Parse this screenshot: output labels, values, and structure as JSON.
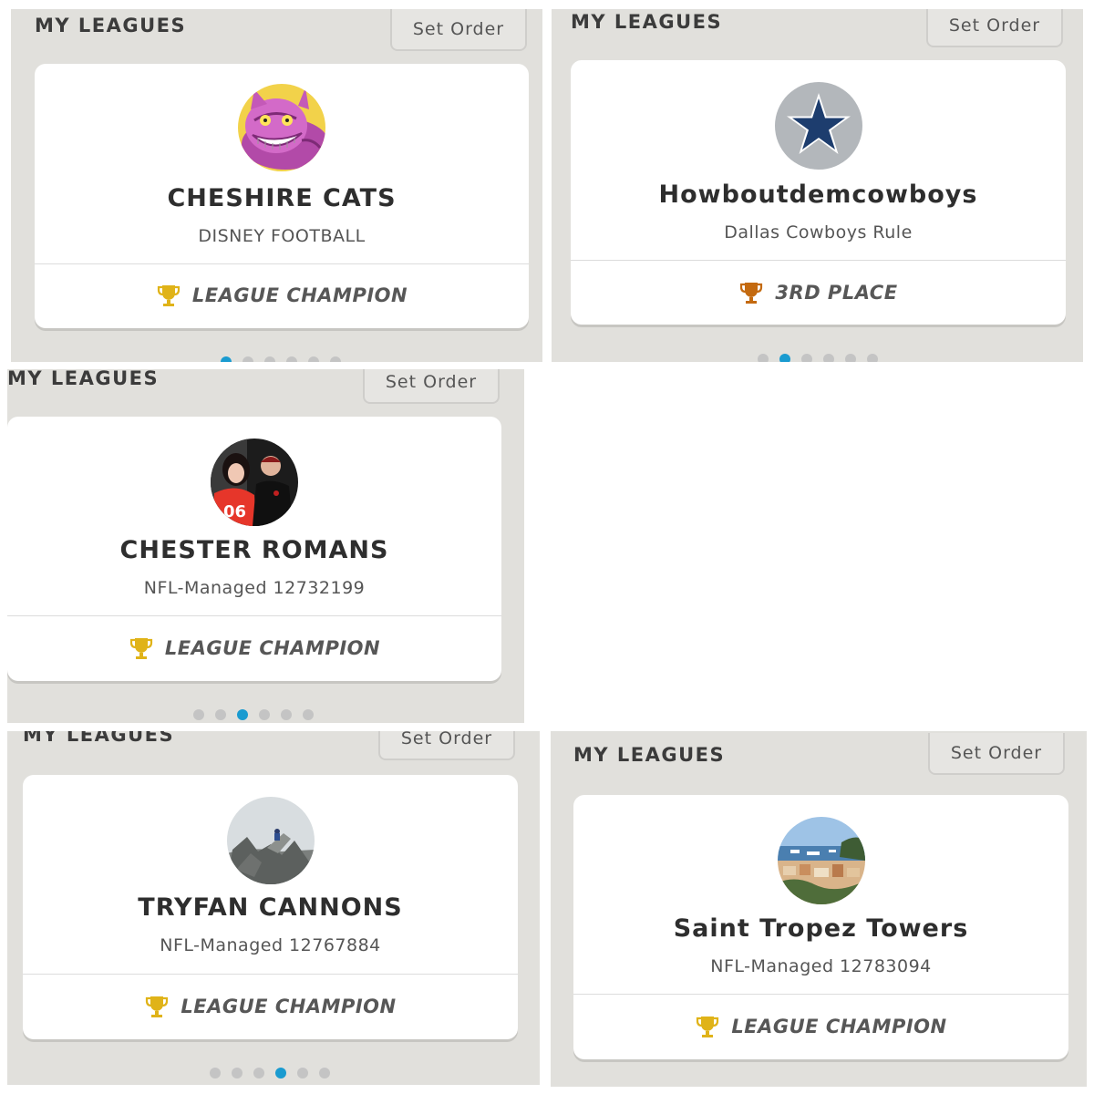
{
  "header_title": "MY LEAGUES",
  "set_order_label": "Set Order",
  "colors": {
    "panel_bg": "#e1e0dc",
    "card_bg": "#ffffff",
    "gold_trophy": "#e0b318",
    "bronze_trophy": "#c46a10",
    "active_dot": "#1a9bd0",
    "inactive_dot": "#c4c4c4"
  },
  "panels": [
    {
      "team_name": "CHESHIRE CATS",
      "league_name": "DISNEY FOOTBALL",
      "achievement": "LEAGUE CHAMPION",
      "trophy": "gold",
      "avatar": "cheshire-cat-avatar",
      "page_indicator": {
        "total": 6,
        "active": 1
      }
    },
    {
      "team_name": "Howboutdemcowboys",
      "league_name": "Dallas Cowboys Rule",
      "achievement": "3RD PLACE",
      "trophy": "bronze",
      "avatar": "cowboys-star-avatar",
      "page_indicator": {
        "total": 6,
        "active": 2
      }
    },
    {
      "team_name": "CHESTER ROMANS",
      "league_name": "NFL-Managed 12732199",
      "achievement": "LEAGUE CHAMPION",
      "trophy": "gold",
      "avatar": "couple-photo-avatar",
      "page_indicator": {
        "total": 6,
        "active": 3
      }
    },
    {
      "team_name": "TRYFAN CANNONS",
      "league_name": "NFL-Managed 12767884",
      "achievement": "LEAGUE CHAMPION",
      "trophy": "gold",
      "avatar": "mountain-rock-avatar",
      "page_indicator": {
        "total": 6,
        "active": 4
      }
    },
    {
      "team_name": "Saint Tropez Towers",
      "league_name": "NFL-Managed 12783094",
      "achievement": "LEAGUE CHAMPION",
      "trophy": "gold",
      "avatar": "harbor-town-avatar"
    }
  ]
}
